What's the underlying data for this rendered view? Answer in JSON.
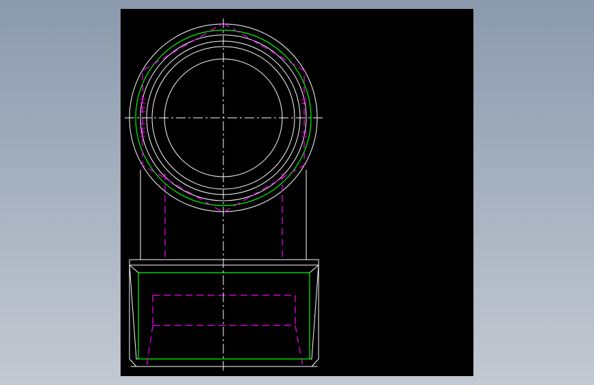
{
  "canvas": {
    "background": "#000000"
  },
  "colors": {
    "page_gradient_top": "#8b9aad",
    "page_gradient_bottom": "#c3c9d2",
    "outline": "#ffffff",
    "thread": "#00ff00",
    "hidden": "#ff00ff",
    "centerline": "#ffffff"
  },
  "drawing": {
    "views": [
      "top-view",
      "front-view"
    ],
    "line_types": [
      "visible-edge",
      "thread-line",
      "hidden-line",
      "center-line"
    ]
  }
}
